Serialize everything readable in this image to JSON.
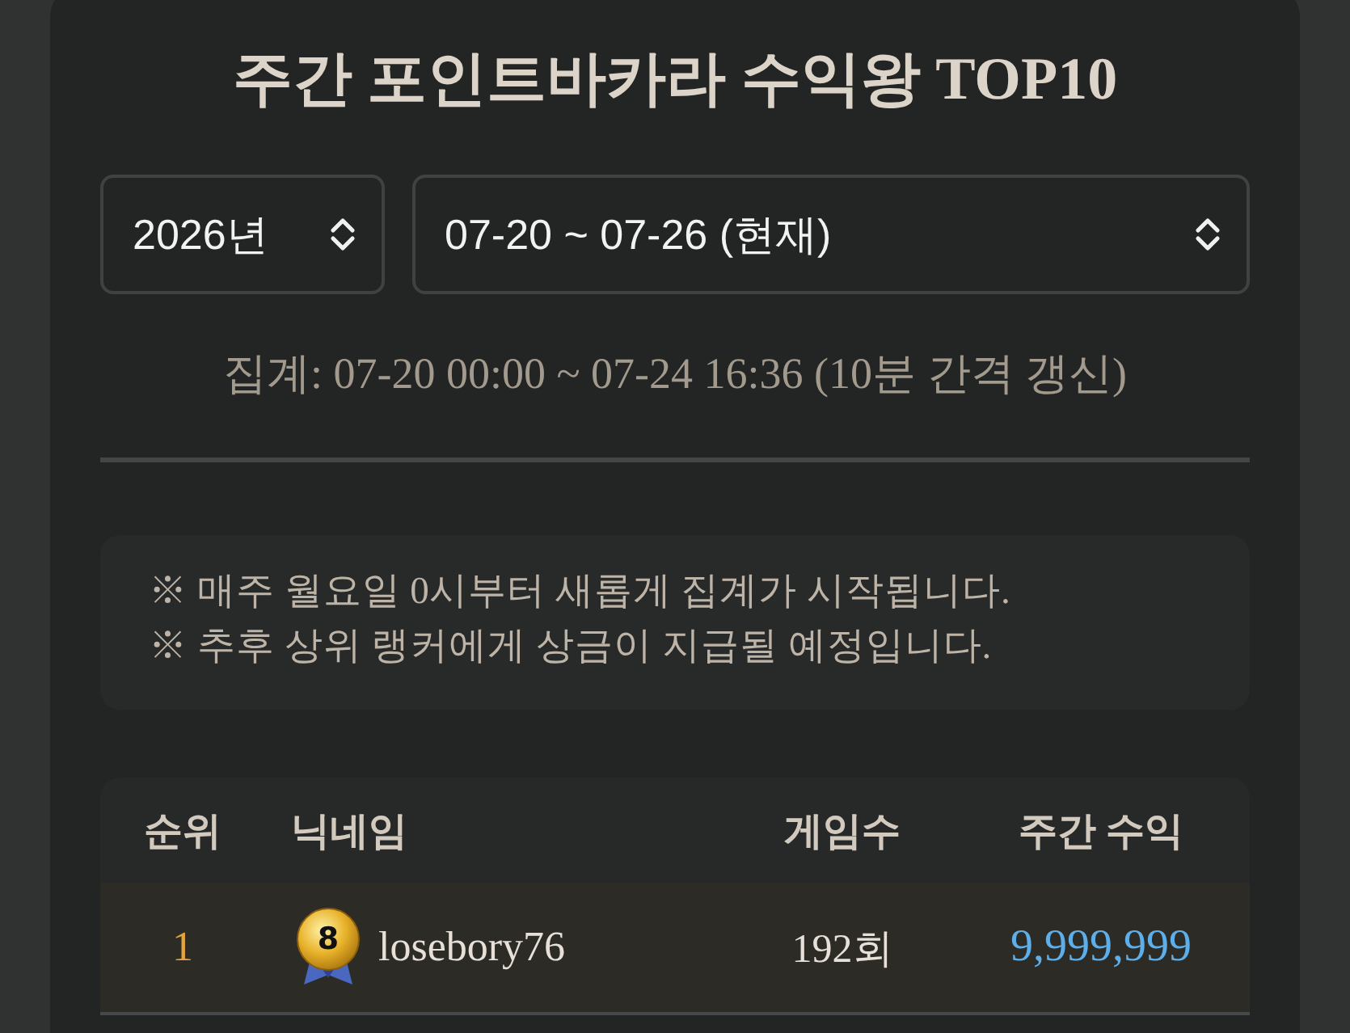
{
  "title": "주간 포인트바카라 수익왕 TOP10",
  "filters": {
    "year": {
      "value": "2026년"
    },
    "week": {
      "value": "07-20 ~ 07-26 (현재)"
    }
  },
  "summary": "집계: 07-20 00:00 ~ 07-24 16:36 (10분 간격 갱신)",
  "notices": [
    "※ 매주 월요일 0시부터 새롭게 집계가 시작됩니다.",
    "※ 추후 상위 랭커에게 상금이 지급될 예정입니다."
  ],
  "table": {
    "columns": [
      "순위",
      "닉네임",
      "게임수",
      "주간 수익"
    ],
    "rows": [
      {
        "rank": "1",
        "badge": "8",
        "nickname": "losebory76",
        "games": "192회",
        "profit": "9,999,999",
        "highlighted": true
      }
    ]
  }
}
